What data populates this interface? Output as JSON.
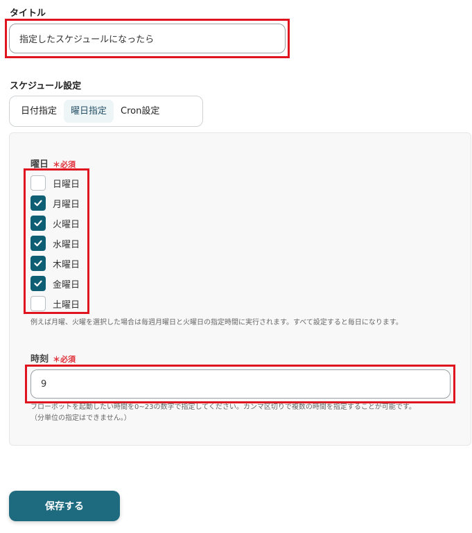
{
  "title": {
    "label": "タイトル",
    "value": "指定したスケジュールになったら"
  },
  "schedule": {
    "label": "スケジュール設定",
    "tabs": [
      {
        "label": "日付指定",
        "active": false
      },
      {
        "label": "曜日指定",
        "active": true
      },
      {
        "label": "Cron設定",
        "active": false
      }
    ]
  },
  "weekdays": {
    "label": "曜日",
    "required": "＊必須",
    "days": [
      {
        "label": "日曜日",
        "checked": false
      },
      {
        "label": "月曜日",
        "checked": true
      },
      {
        "label": "火曜日",
        "checked": true
      },
      {
        "label": "水曜日",
        "checked": true
      },
      {
        "label": "木曜日",
        "checked": true
      },
      {
        "label": "金曜日",
        "checked": true
      },
      {
        "label": "土曜日",
        "checked": false
      }
    ],
    "help": "例えば月曜、火曜を選択した場合は毎週月曜日と火曜日の指定時間に実行されます。すべて設定すると毎日になります。"
  },
  "time": {
    "label": "時刻",
    "required": "＊必須",
    "value": "9",
    "help_line1": "フローボットを起動したい時間を0~23の数字で指定してください。カンマ区切りで複数の時間を指定することが可能です。",
    "help_line2": "（分単位の指定はできません。）"
  },
  "save_button": {
    "label": "保存する"
  },
  "colors": {
    "accent": "#1e6a7f",
    "checkbox": "#0f5f74",
    "highlight_frame": "#e0141e",
    "required": "#e0303a"
  }
}
